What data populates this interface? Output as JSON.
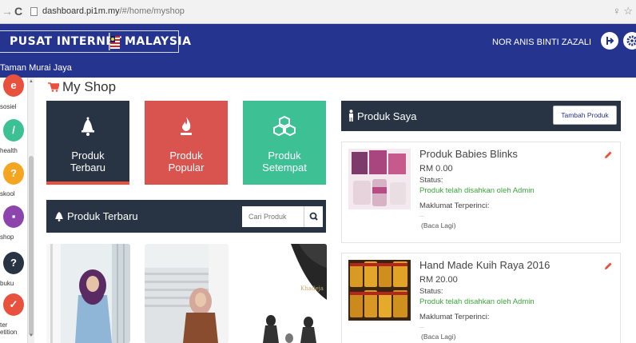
{
  "browser": {
    "url_host": "dashboard.pi1m.my",
    "url_path": "/#/home/myshop"
  },
  "header": {
    "logo_left": "PUSAT INTERNET",
    "logo_right": "MALAYSIA",
    "location": "Taman Murai Jaya",
    "user_name": "NOR ANIS BINTI ZAZALI",
    "brand_color": "#25358f"
  },
  "sidebar": {
    "items": [
      {
        "label": "sosiel",
        "color": "#e8513d"
      },
      {
        "label": "health",
        "color": "#3dc194"
      },
      {
        "label": "skool",
        "color": "#f4a623"
      },
      {
        "label": "shop",
        "color": "#8e44ad"
      },
      {
        "label": "buku",
        "color": "#283444"
      },
      {
        "label": "ter etition",
        "color": "#e8513d"
      }
    ]
  },
  "page": {
    "title": "My Shop"
  },
  "tiles": [
    {
      "line1": "Produk",
      "line2": "Terbaru",
      "icon": "bell-icon",
      "color": "#283444"
    },
    {
      "line1": "Produk",
      "line2": "Popular",
      "icon": "fire-icon",
      "color": "#d9534f"
    },
    {
      "line1": "Produk",
      "line2": "Setempat",
      "icon": "cubes-icon",
      "color": "#3dc194"
    }
  ],
  "terbaru": {
    "title": "Produk Terbaru",
    "search_placeholder": "Cari Produk"
  },
  "saya": {
    "title": "Produk Saya",
    "add_button": "Tambah Produk"
  },
  "products": [
    {
      "name": "Produk Babies Blinks",
      "price": "RM 0.00",
      "status_label": "Status:",
      "status": "Produk telah disahkan oleh Admin",
      "detail_label": "Maklumat Terperinci:",
      "dots": "...",
      "more": "(Baca Lagi)"
    },
    {
      "name": "Hand Made Kuih Raya 2016",
      "price": "RM 20.00",
      "status_label": "Status:",
      "status": "Produk telah disahkan oleh Admin",
      "detail_label": "Maklumat Terperinci:",
      "dots": "...",
      "more": "(Baca Lagi)"
    }
  ]
}
